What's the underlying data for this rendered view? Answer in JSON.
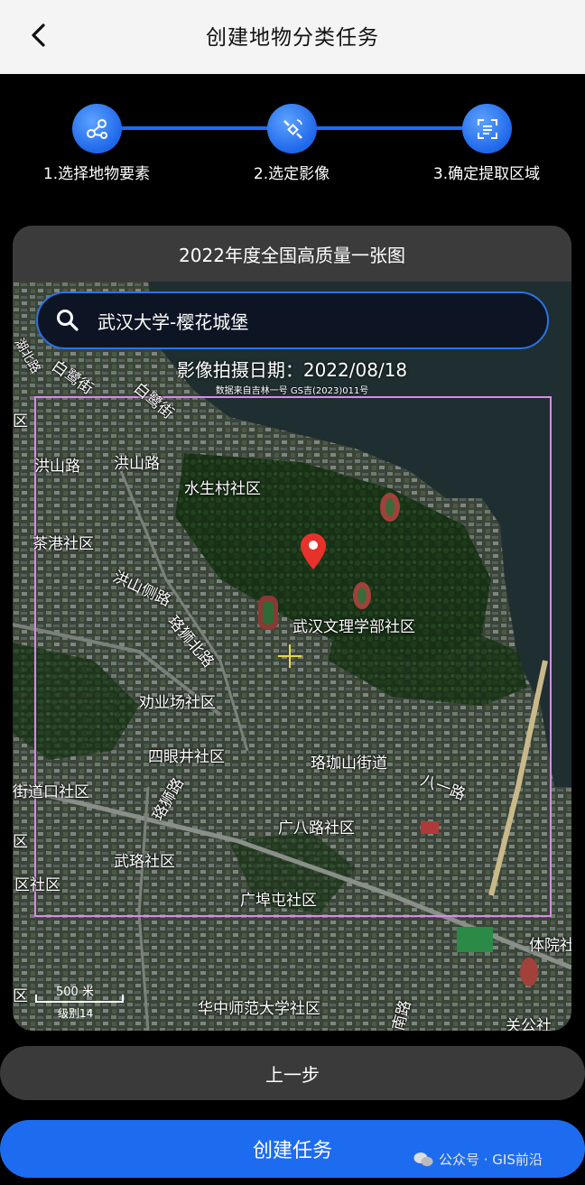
{
  "header": {
    "title": "创建地物分类任务",
    "back_icon": "chevron-left-icon"
  },
  "steps": [
    {
      "label": "1.选择地物要素",
      "icon": "molecule-icon",
      "active": true
    },
    {
      "label": "2.选定影像",
      "icon": "satellite-icon",
      "active": true
    },
    {
      "label": "3.确定提取区域",
      "icon": "scan-area-icon",
      "active": true
    }
  ],
  "map_card": {
    "title": "2022年度全国高质量一张图",
    "search": {
      "value": "武汉大学-樱花城堡",
      "icon": "search-icon"
    },
    "capture_date": "影像拍摄日期：2022/08/18",
    "data_source": "数据来自吉林一号 GS吉(2023)011号",
    "labels": [
      "白鹭街",
      "白鹭街",
      "洪山路",
      "洪山路",
      "水生村社区",
      "茶港社区",
      "洪山侧路",
      "珞狮北路",
      "武汉文理学部社区",
      "劝业场社区",
      "四眼井社区",
      "珞珈山街道",
      "街道口社区",
      "八一路",
      "珞狮路",
      "广八路社区",
      "武珞社区",
      "区社区",
      "广埠屯社区",
      "体院社",
      "华中师范大学社区",
      "关公社",
      "南路",
      "区",
      "区",
      "区",
      "湖北路"
    ],
    "scale": {
      "distance": "500 米",
      "level": "级别14"
    },
    "selection_color": "#d88ae8",
    "pin_color": "#e8312a"
  },
  "buttons": {
    "prev": "上一步",
    "create": "创建任务"
  },
  "watermark": "公众号 · GIS前沿",
  "colors": {
    "accent": "#1d6cf0",
    "header_bg": "#f4f4f4",
    "card_title_bg": "#3b3b3b",
    "prev_btn_bg": "#3a3a3a"
  }
}
